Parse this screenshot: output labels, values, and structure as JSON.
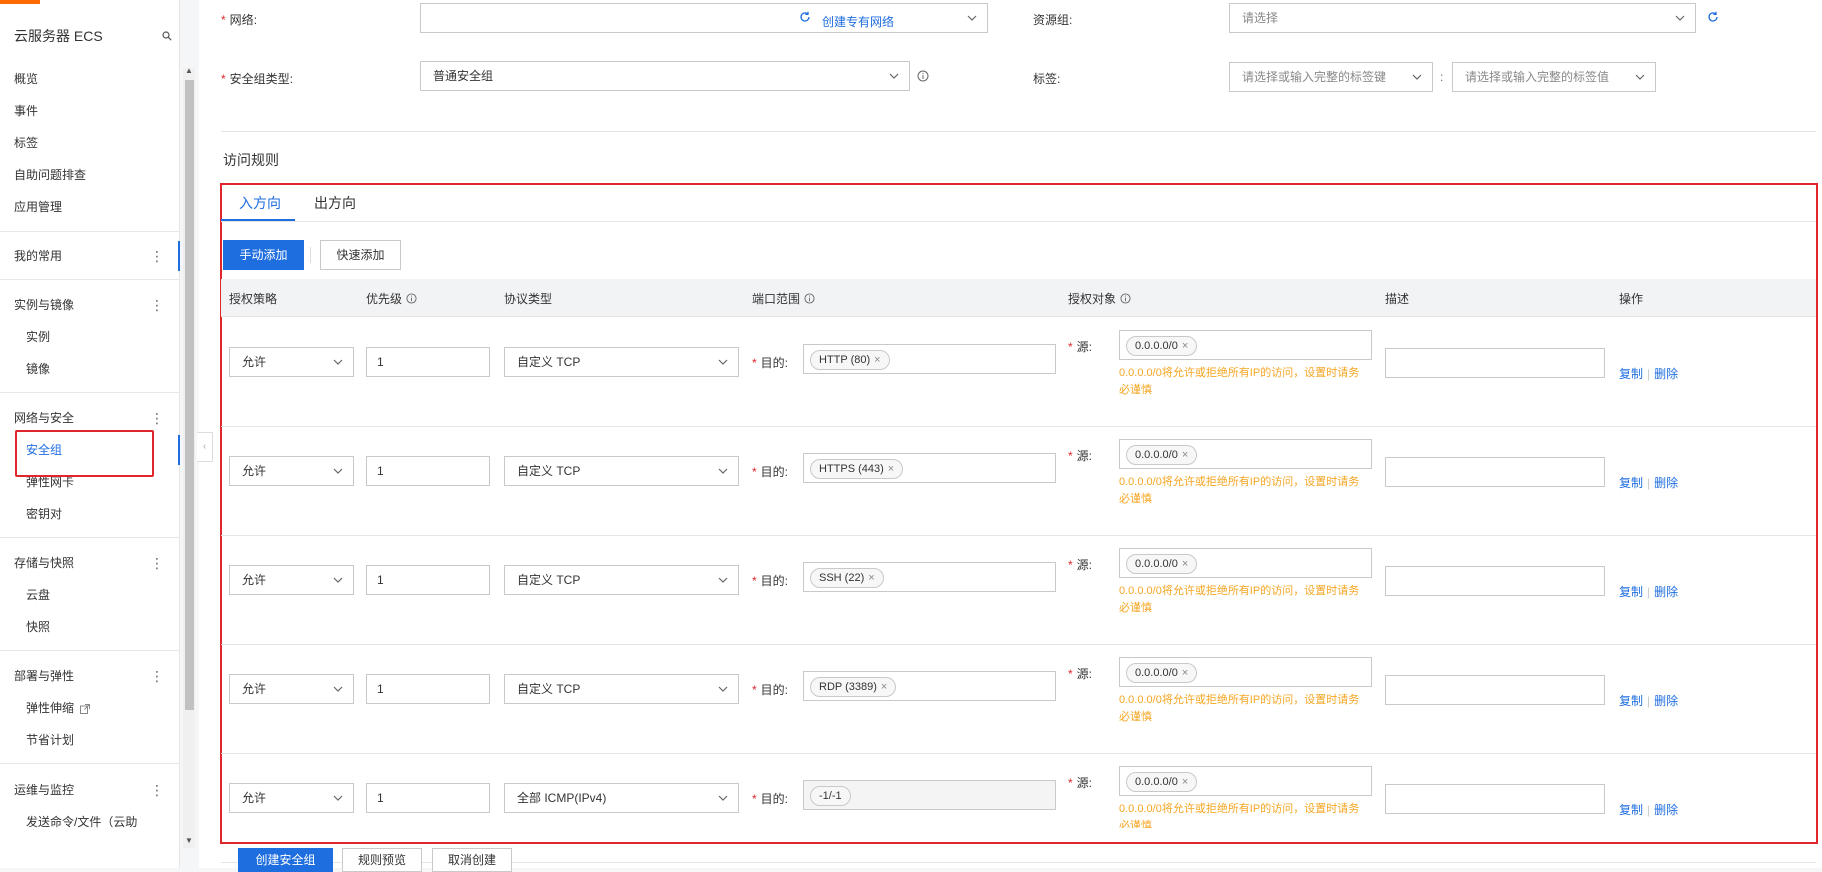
{
  "sidebar": {
    "title": "云服务器 ECS",
    "top_items": [
      "概览",
      "事件",
      "标签",
      "自助问题排查",
      "应用管理"
    ],
    "favorites": "我的常用",
    "groups": [
      {
        "head": "实例与镜像",
        "items": [
          "实例",
          "镜像"
        ]
      },
      {
        "head": "网络与安全",
        "items": [
          "安全组",
          "弹性网卡",
          "密钥对"
        ]
      },
      {
        "head": "存储与快照",
        "items": [
          "云盘",
          "快照"
        ]
      },
      {
        "head": "部署与弹性",
        "items": [
          "弹性伸缩",
          "节省计划"
        ]
      },
      {
        "head": "运维与监控",
        "items": [
          "发送命令/文件（云助"
        ]
      }
    ]
  },
  "form": {
    "network_label": "网络",
    "network_value": "",
    "create_vpc_link": "创建专有网络",
    "resource_group_label": "资源组",
    "resource_group_placeholder": "请选择",
    "sg_type_label": "安全组类型",
    "sg_type_value": "普通安全组",
    "tags_label": "标签",
    "tag_key_placeholder": "请选择或输入完整的标签键",
    "tag_value_placeholder": "请选择或输入完整的标签值"
  },
  "rules": {
    "section_title": "访问规则",
    "tabs": [
      "入方向",
      "出方向"
    ],
    "manual_add": "手动添加",
    "quick_add": "快速添加",
    "headers": [
      "授权策略",
      "优先级",
      "协议类型",
      "端口范围",
      "授权对象",
      "描述",
      "操作"
    ],
    "dest_label": "目的:",
    "src_label": "源:",
    "warning": "0.0.0.0/0将允许或拒绝所有IP的访问，设置时请务必谨慎",
    "copy": "复制",
    "delete": "删除",
    "rows": [
      {
        "policy": "允许",
        "priority": "1",
        "protocol": "自定义 TCP",
        "port": "HTTP (80)",
        "source": "0.0.0.0/0"
      },
      {
        "policy": "允许",
        "priority": "1",
        "protocol": "自定义 TCP",
        "port": "HTTPS (443)",
        "source": "0.0.0.0/0"
      },
      {
        "policy": "允许",
        "priority": "1",
        "protocol": "自定义 TCP",
        "port": "SSH (22)",
        "source": "0.0.0.0/0"
      },
      {
        "policy": "允许",
        "priority": "1",
        "protocol": "自定义 TCP",
        "port": "RDP (3389)",
        "source": "0.0.0.0/0"
      },
      {
        "policy": "允许",
        "priority": "1",
        "protocol": "全部 ICMP(IPv4)",
        "port": "-1/-1",
        "source": "0.0.0.0/0"
      }
    ]
  },
  "footer": {
    "create": "创建安全组",
    "preview": "规则预览",
    "cancel": "取消创建"
  }
}
